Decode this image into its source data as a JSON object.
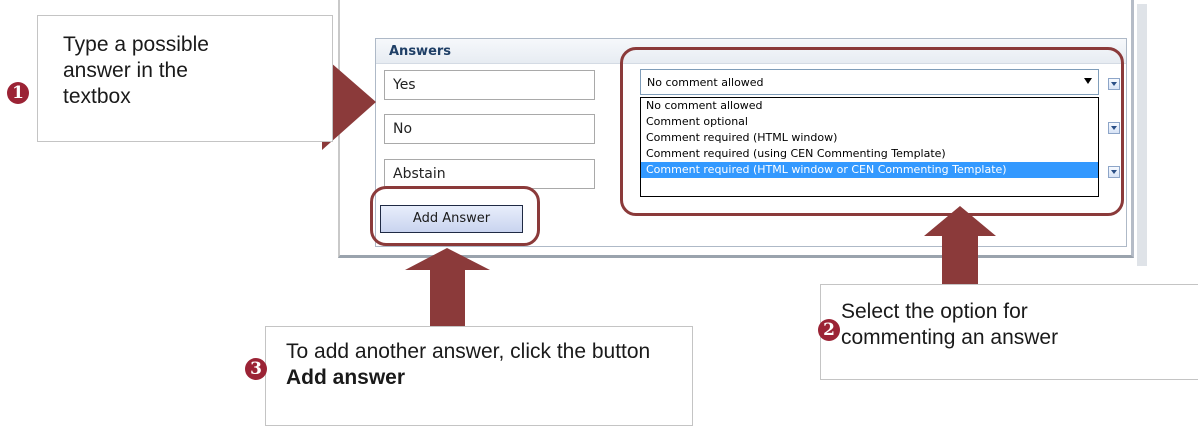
{
  "answers_panel": {
    "title": "Answers",
    "answers": [
      "Yes",
      "No",
      "Abstain"
    ],
    "add_button_label": "Add Answer"
  },
  "comment_select": {
    "selected": "No comment allowed",
    "options": [
      "No comment allowed",
      "Comment optional",
      "Comment required (HTML window)",
      "Comment required (using CEN Commenting Template)",
      "Comment required (HTML window or CEN Commenting Template)"
    ],
    "highlighted_option": "Comment required (HTML window or CEN Commenting Template)"
  },
  "callouts": [
    {
      "number": "1",
      "text": "Type a possible answer in the textbox"
    },
    {
      "number": "2",
      "text": "Select the option for commenting an answer"
    },
    {
      "number": "3",
      "text_before": "To add another answer, click the button ",
      "text_bold": "Add answer"
    }
  ],
  "colors": {
    "accent": "#8b3a3a",
    "badge": "#9b2335",
    "header_text": "#1f3f66",
    "selection": "#3399ff"
  }
}
